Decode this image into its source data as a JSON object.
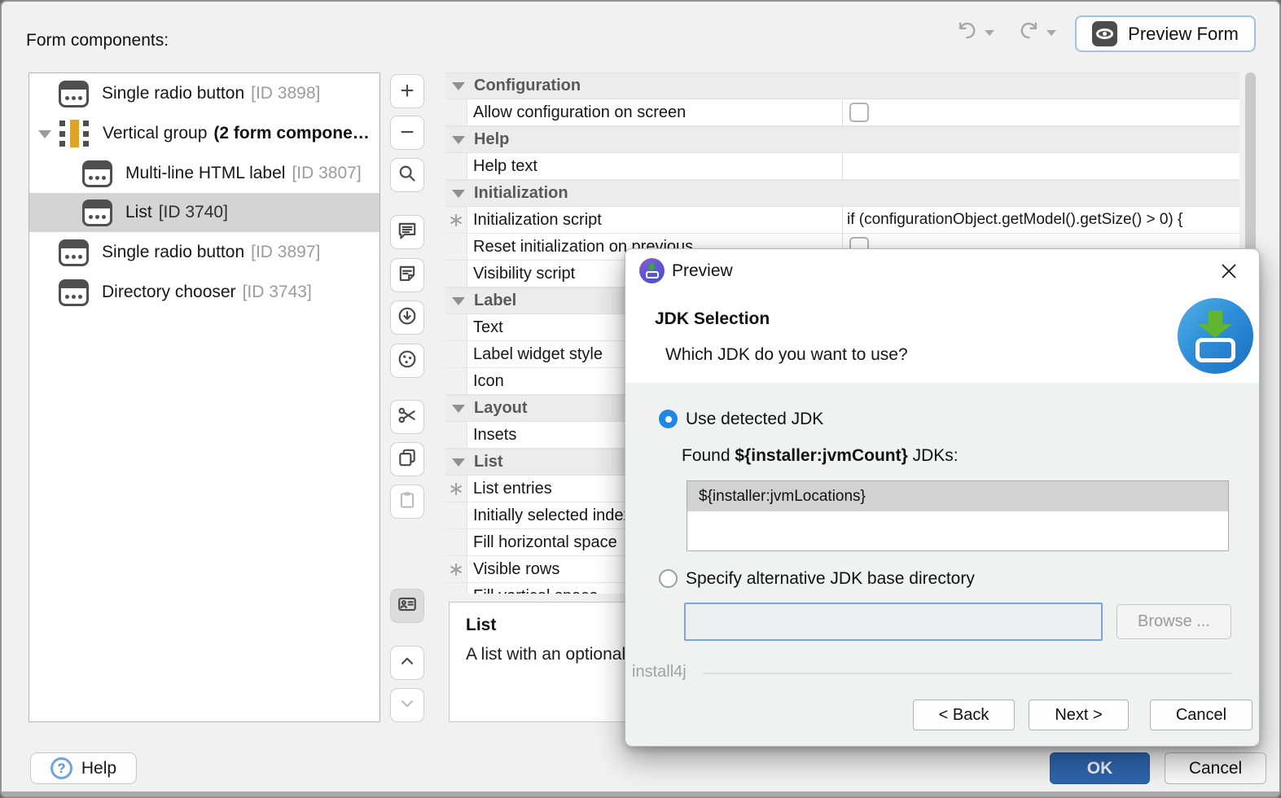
{
  "window": {
    "form_components_label": "Form components:",
    "preview_form_label": "Preview Form",
    "help_label": "Help",
    "help_icon_glyph": "?",
    "ok_label": "OK",
    "cancel_label": "Cancel"
  },
  "tree": {
    "items": [
      {
        "icon": "component",
        "label": "Single radio button",
        "id_text": "[ID 3898]",
        "level": 1,
        "selected": false,
        "expanded": false
      },
      {
        "icon": "vertical-group",
        "label": "Vertical group",
        "bold_suffix": "(2 form compone…",
        "level": 1,
        "selected": false,
        "expanded": true
      },
      {
        "icon": "component",
        "label": "Multi-line HTML label",
        "id_text": "[ID 3807]",
        "level": 2,
        "selected": false,
        "expanded": false
      },
      {
        "icon": "component",
        "label": "List",
        "id_text": "[ID 3740]",
        "level": 2,
        "selected": true,
        "expanded": false
      },
      {
        "icon": "component",
        "label": "Single radio button",
        "id_text": "[ID 3897]",
        "level": 1,
        "selected": false,
        "expanded": false
      },
      {
        "icon": "component",
        "label": "Directory chooser",
        "id_text": "[ID 3743]",
        "level": 1,
        "selected": false,
        "expanded": false
      }
    ]
  },
  "toolbar": {
    "buttons": [
      {
        "name": "add",
        "disabled": false,
        "toggled": false
      },
      {
        "name": "remove",
        "disabled": false,
        "toggled": false
      },
      {
        "name": "search",
        "disabled": false,
        "toggled": false
      },
      {
        "name": "comment",
        "disabled": false,
        "toggled": false
      },
      {
        "name": "note",
        "disabled": false,
        "toggled": false
      },
      {
        "name": "download",
        "disabled": false,
        "toggled": false
      },
      {
        "name": "socket",
        "disabled": false,
        "toggled": false
      },
      {
        "name": "cut",
        "disabled": false,
        "toggled": false
      },
      {
        "name": "copy",
        "disabled": false,
        "toggled": false
      },
      {
        "name": "paste",
        "disabled": true,
        "toggled": false
      },
      {
        "name": "contact-card",
        "disabled": false,
        "toggled": true
      },
      {
        "name": "move-up",
        "disabled": false,
        "toggled": false
      },
      {
        "name": "move-down",
        "disabled": true,
        "toggled": false
      }
    ]
  },
  "properties": {
    "rows": [
      {
        "type": "header",
        "label": "Configuration"
      },
      {
        "type": "prop",
        "label": "Allow configuration on screen",
        "asterisk": false,
        "checkbox": true,
        "value": ""
      },
      {
        "type": "header",
        "label": "Help"
      },
      {
        "type": "prop",
        "label": "Help text",
        "asterisk": false,
        "checkbox": false,
        "value": ""
      },
      {
        "type": "header",
        "label": "Initialization"
      },
      {
        "type": "prop",
        "label": "Initialization script",
        "asterisk": true,
        "checkbox": false,
        "value": "if (configurationObject.getModel().getSize() > 0) {"
      },
      {
        "type": "prop",
        "label": "Reset initialization on previous",
        "asterisk": false,
        "checkbox": true,
        "value": ""
      },
      {
        "type": "prop",
        "label": "Visibility script",
        "asterisk": false,
        "checkbox": false,
        "value": ""
      },
      {
        "type": "header",
        "label": "Label"
      },
      {
        "type": "prop",
        "label": "Text",
        "asterisk": false,
        "checkbox": false,
        "value": ""
      },
      {
        "type": "prop",
        "label": "Label widget style",
        "asterisk": false,
        "checkbox": false,
        "value": ""
      },
      {
        "type": "prop",
        "label": "Icon",
        "asterisk": false,
        "checkbox": false,
        "value": ""
      },
      {
        "type": "header",
        "label": "Layout"
      },
      {
        "type": "prop",
        "label": "Insets",
        "asterisk": false,
        "checkbox": false,
        "value": ""
      },
      {
        "type": "header",
        "label": "List"
      },
      {
        "type": "prop",
        "label": "List entries",
        "asterisk": true,
        "checkbox": false,
        "value": ""
      },
      {
        "type": "prop",
        "label": "Initially selected index",
        "asterisk": false,
        "checkbox": false,
        "value": ""
      },
      {
        "type": "prop",
        "label": "Fill horizontal space",
        "asterisk": false,
        "checkbox": false,
        "value": ""
      },
      {
        "type": "prop",
        "label": "Visible rows",
        "asterisk": true,
        "checkbox": false,
        "value": ""
      },
      {
        "type": "prop",
        "label": "Fill vertical space",
        "asterisk": false,
        "checkbox": false,
        "value": ""
      }
    ],
    "asterisk_glyph": "∗"
  },
  "description_box": {
    "title": "List",
    "text": "A list with an optional label."
  },
  "dialog": {
    "title": "Preview",
    "heading": "JDK Selection",
    "question": "Which JDK do you want to use?",
    "radio_detected_label": "Use detected JDK",
    "found_prefix": "Found ",
    "found_var": "${installer:jvmCount}",
    "found_suffix": " JDKs:",
    "list_selected_entry": "${installer:jvmLocations}",
    "radio_alternative_label": "Specify alternative JDK base directory",
    "directory_field_value": "",
    "browse_label": "Browse ...",
    "brand": "install4j",
    "back_label": "< Back",
    "next_label": "Next >",
    "cancel_label": "Cancel"
  },
  "colors": {
    "accent_radio_blue": "#1e88e5",
    "ok_button_blue": "#2d64ab",
    "group_icon_amber": "#dfa32a",
    "install4j_icon_blue": "#2f8fd8",
    "install4j_icon_green": "#61b531",
    "preview_button_border_blue": "#9ec3e8",
    "selected_row_gray": "#d4d4d4",
    "window_background": "#f1f1f1"
  }
}
